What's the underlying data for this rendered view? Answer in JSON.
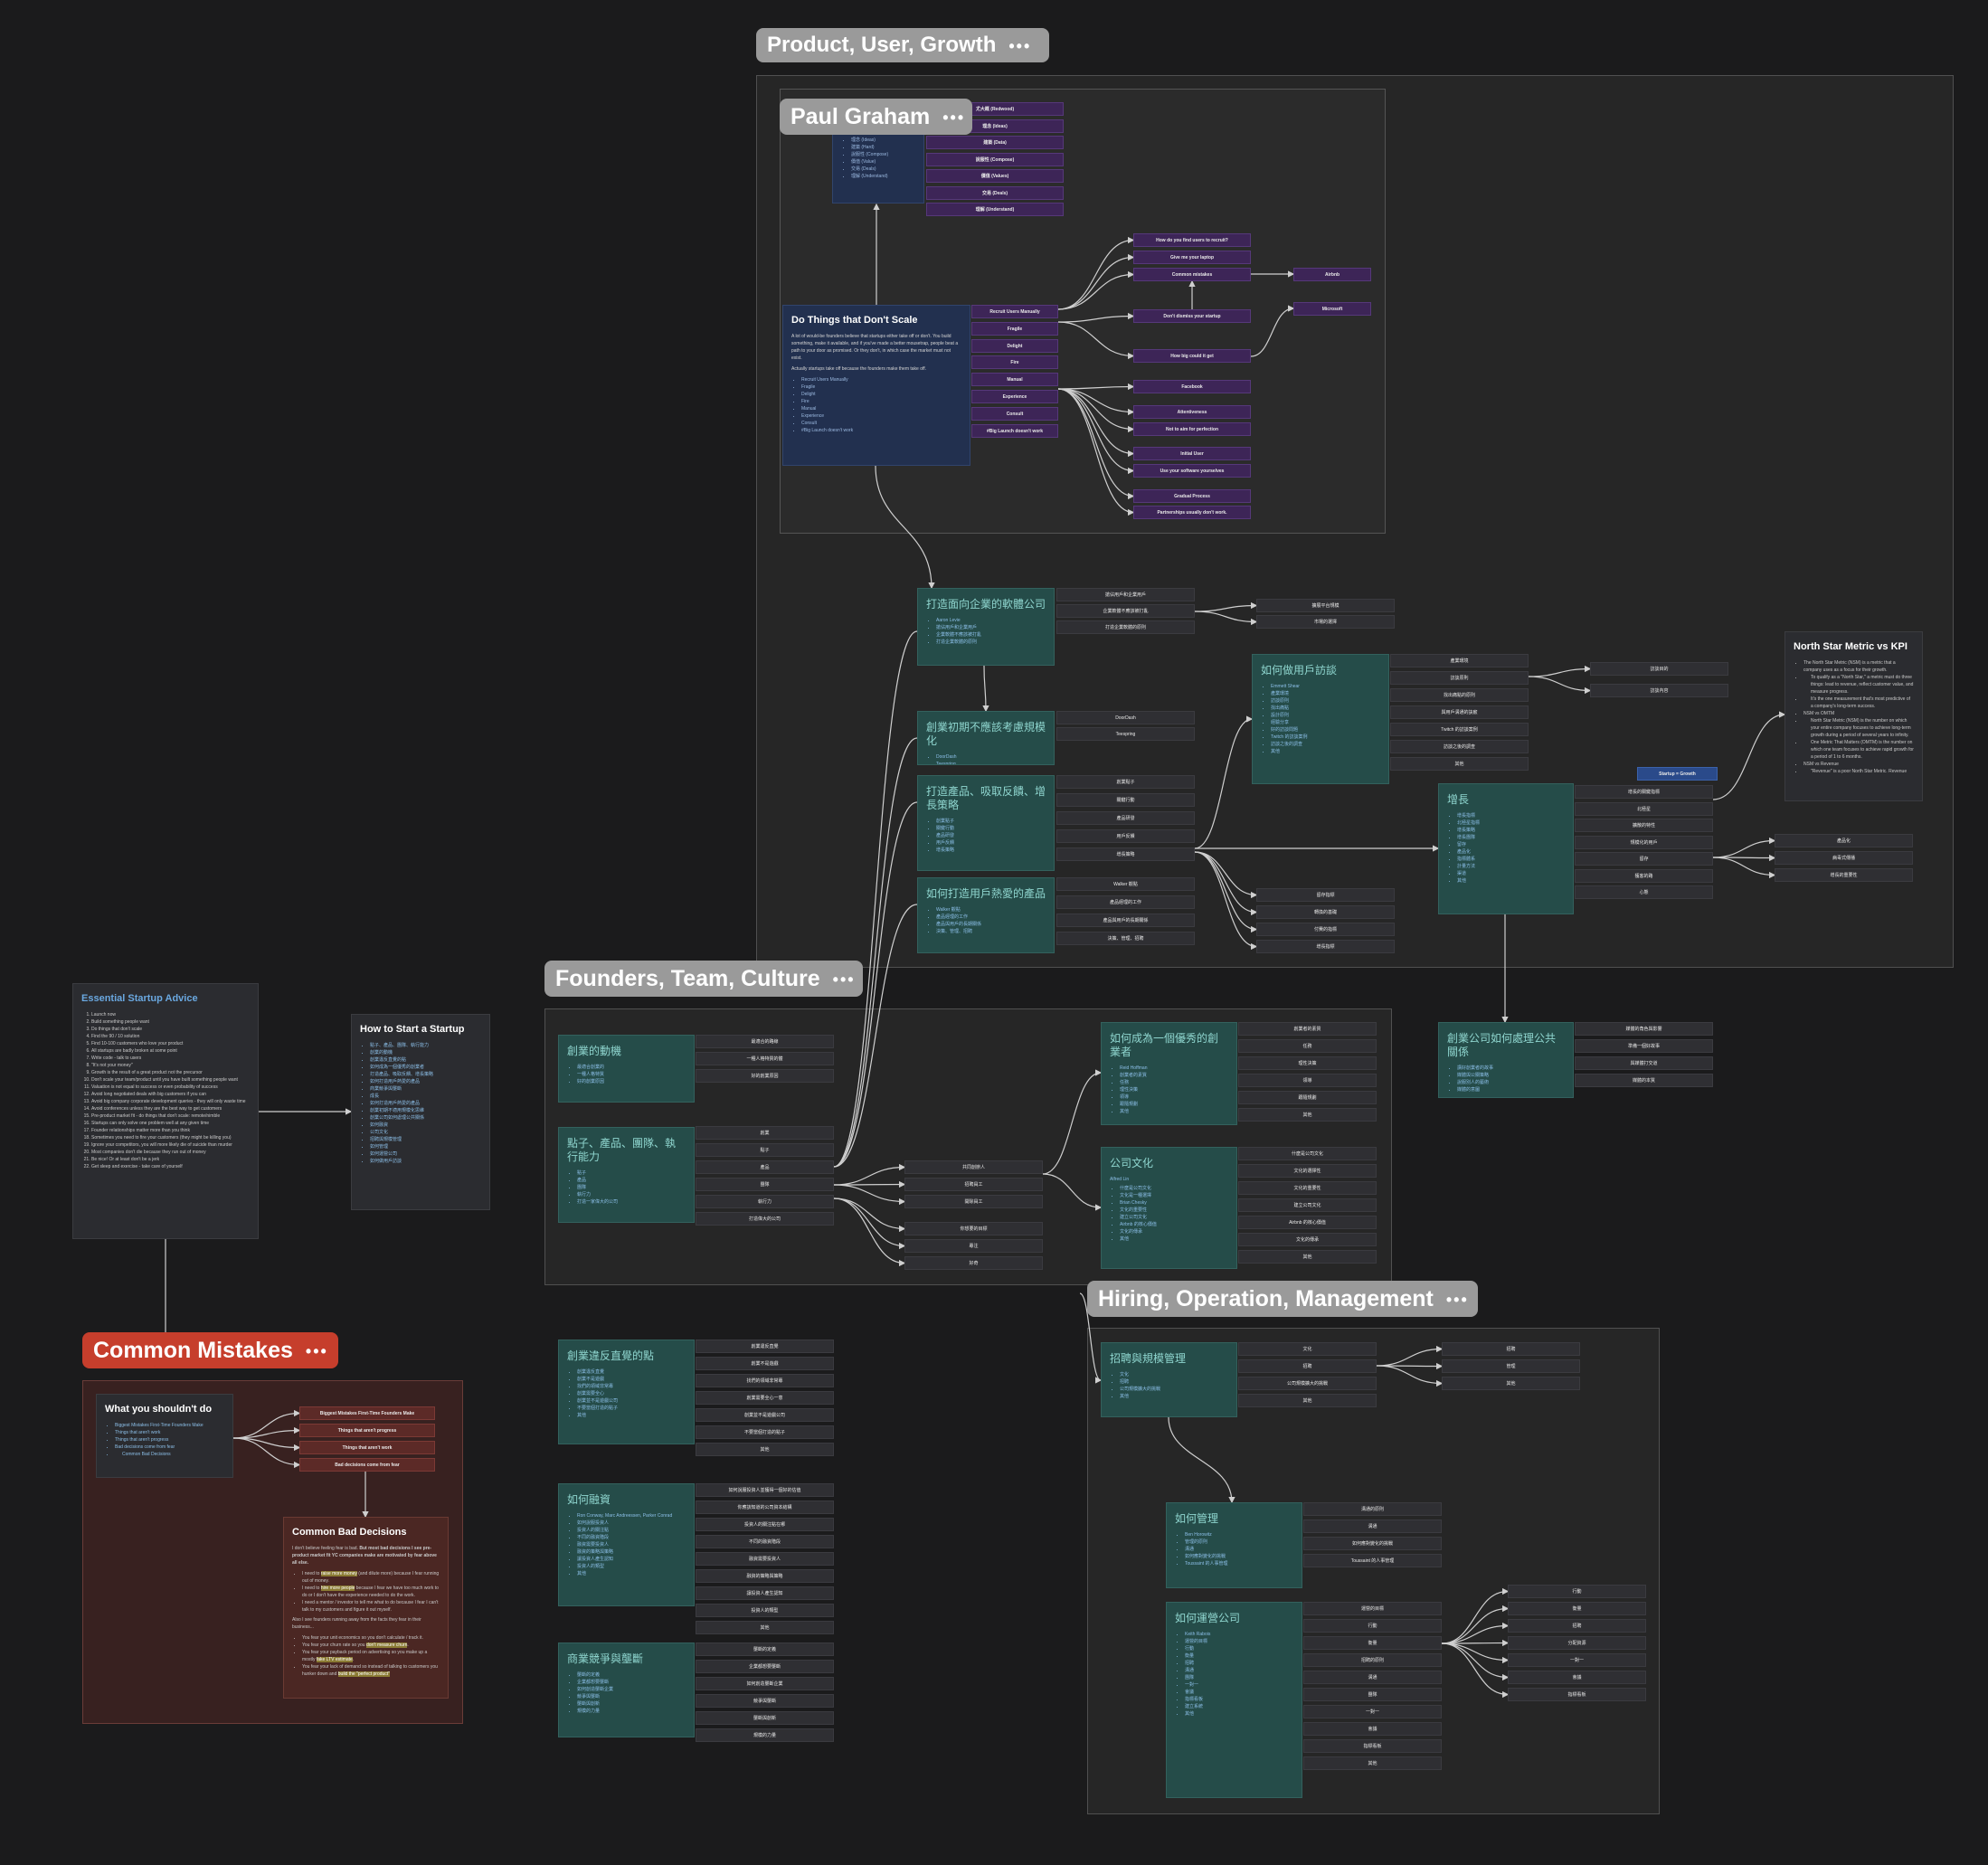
{
  "groups": {
    "product": {
      "label": "Product, User, Growth"
    },
    "paul": {
      "label": "Paul Graham"
    },
    "founders": {
      "label": "Founders, Team, Culture"
    },
    "hiring": {
      "label": "Hiring, Operation, Management"
    },
    "mistakes": {
      "label": "Common Mistakes"
    }
  },
  "label_menu": "•••",
  "notes": {
    "essential": {
      "title": "Essential Startup Advice",
      "items": [
        "Launch now",
        "Build something people want",
        "Do things that don't scale",
        "Find the 90 / 10 solution",
        "Find 10-100 customers who love your product",
        "All startups are badly broken at some point",
        "Write code - talk to users",
        "\"It's not your money\"",
        "Growth is the result of a great product not the precursor",
        "Don't scale your team/product until you have built something people want",
        "Valuation is not equal to success or even probability of success",
        "Avoid long negotiated deals with big customers if you can",
        "Avoid big company corporate development queries - they will only waste time",
        "Avoid conferences unless they are the best way to get customers",
        "Pre-product market fit - do things that don't scale: remote/nimble",
        "Startups can only solve one problem well at any given time",
        "Founder relationships matter more than you think",
        "Sometimes you need to fire your customers (they might be killing you)",
        "Ignore your competitors, you will more likely die of suicide than murder",
        "Most companies don't die because they run out of money",
        "Be nice! Or at least don't be a jerk",
        "Get sleep and exercise - take care of yourself"
      ]
    },
    "howto": {
      "title": "How to Start a Startup",
      "items": [
        "點子、產品、團隊、執行能力",
        "創業的動機",
        "創業違反直覺的點",
        "如何成為一個優秀的創業者",
        "打造產品、吸取反饋、增長策略",
        "如何打造用戶熱愛的產品",
        "商業競爭與壟斷",
        "成長",
        "如何打造用戶熱愛的產品",
        "創業初期不適用規模化思維",
        "創業公司如何處理公共關係",
        "如何融資",
        "公司文化",
        "招聘與規模管理",
        "如何管理",
        "如何運營公司",
        "如何做用戶訪談"
      ]
    },
    "dothings": {
      "title": "Do Things that Don't Scale",
      "p1": "A lot of would-be founders believe that startups either take off or don't. You build something, make it available, and if you've made a better mousetrap, people beat a path to your door as promised. Or they don't, in which case the market must not exist.",
      "p2": "Actually startups take off because the founders make them take off.",
      "items": [
        "Recruit Users Manually",
        "Fragile",
        "Delight",
        "Fire",
        "Manual",
        "Experience",
        "Consult",
        "#Big Launch doesn't work"
      ]
    },
    "pgwords": {
      "items": [
        "理念 (Ideas)",
        "建築 (Hard)",
        "說服性 (Compose)",
        "價值 (Value)",
        "交易 (Deals)",
        "理解 (Understand)"
      ]
    },
    "enterprise": {
      "title": "打造面向企業的軟體公司",
      "items": [
        "Aaron Levie",
        "搶佔用戶和企業用戶",
        "企業軟體不應該被打亂",
        "打造企業軟體的原則"
      ]
    },
    "noscale": {
      "title": "創業初期不應該考慮規模化",
      "items": [
        "DoorDash",
        "Teespring"
      ]
    },
    "feedback": {
      "title": "打造產品、吸取反饋、增長策略",
      "items": [
        "創業點子",
        "關鍵行動",
        "產品研發",
        "用戶反饋",
        "增長策略"
      ]
    },
    "lovedprod": {
      "title": "如何打造用戶熱愛的產品",
      "items": [
        "Walker 觀點",
        "產品經理的工作",
        "產品與用戶的長期關係",
        "決策、管理、招聘"
      ]
    },
    "interview": {
      "title": "如何做用戶訪談",
      "items": [
        "Emmett Shear",
        "產業環境",
        "訪談原則",
        "找出痛點",
        "設計原則",
        "經驗分享",
        "好的訪談問題",
        "Twitch 的訪談案例",
        "訪談之後的調查",
        "其他"
      ]
    },
    "growth": {
      "title": "增長",
      "items": [
        "增長指標",
        "北極星指標",
        "增長策略",
        "增長團隊",
        "留存",
        "產品化",
        "指標體系",
        "計量方法",
        "渠道",
        "其他"
      ]
    },
    "northstar": {
      "title": "North Star Metric vs KPI",
      "l1": "The North Star Metric (NSM) is a metric that a company uses as a focus for their growth.",
      "l2": "To qualify as a \"North Star,\" a metric must do three things: lead to revenue, reflect customer value, and measure progress.",
      "l3": "It's the one measurement that's most predictive of a company's long-term success.",
      "l4": "NSM vs OMTM",
      "l5": "North Star Metric (NSM) is the number on which your entire company focuses to achieve long-term growth during a period of several years to infinity.",
      "l6": "One Metric That Matters (OMTM) is the number on which one team focuses to achieve rapid growth for a period of 1 to 6 months.",
      "l7": "NSM vs Revenue",
      "l8": "\"Revenue\" is a poor North Star Metric. Revenue"
    },
    "pr": {
      "title": "創業公司如何處理公共關係",
      "items": [
        "講好創業者的故事",
        "媒體與公關策略",
        "說服別人的藝術",
        "媒體的意圖"
      ]
    },
    "motive": {
      "title": "創業的動機",
      "items": [
        "最適合創業的",
        "一種人格特質",
        "好的創業原因"
      ]
    },
    "ideas": {
      "title": "點子、產品、團隊、執行能力",
      "items": [
        "點子",
        "產品",
        "團隊",
        "執行力",
        "打造一家偉大的公司"
      ]
    },
    "founder": {
      "title": "如何成為一個優秀的創業者",
      "items": [
        "Reid Hoffman",
        "創業者的素質",
        "任務",
        "理性決策",
        "領導",
        "跟隨規劃",
        "其他"
      ]
    },
    "culture": {
      "title": "公司文化",
      "sub": "Alfred Lin",
      "items": [
        "什麼是公司文化",
        "文化是一種選擇",
        "Brian Chesky",
        "文化的重要性",
        "建立公司文化",
        "Airbnb 的核心價值",
        "文化的傳承",
        "其他"
      ]
    },
    "counter": {
      "title": "創業違反直覺的點",
      "items": [
        "創業違反直覺",
        "創業不是遊戲",
        "找們的領域非常專",
        "創業需要全心",
        "創業並不是遊戲公司",
        "不要當個打造的點子",
        "其他"
      ]
    },
    "funding": {
      "title": "如何融資",
      "items": [
        "Ron Conway, Marc Andreessen, Parker Conrad",
        "如何說服投資人",
        "投資人的關注點",
        "不同的融資階段",
        "融資需要投資人",
        "融資的策略與策略",
        "讓投資人產生認知",
        "投資人的類型",
        "其他"
      ]
    },
    "compete": {
      "title": "商業競爭與壟斷",
      "items": [
        "壟斷的定義",
        "企業都想要壟斷",
        "如何創造壟斷企業",
        "競爭與壟斷",
        "壟斷與創新",
        "規模的力量"
      ]
    },
    "hiringmgmt": {
      "title": "招聘與規模管理",
      "items": [
        "文化",
        "招聘",
        "公司規模擴大的挑戰",
        "其他"
      ]
    },
    "manage": {
      "title": "如何管理",
      "items": [
        "Ben Horowitz",
        "管理的原則",
        "溝通",
        "如何應對變化的挑戰",
        "Toussaint 的人事管理"
      ]
    },
    "operate": {
      "title": "如何運營公司",
      "items": [
        "Keith Rabois",
        "運營的目標",
        "行動",
        "衡量",
        "招聘",
        "溝通",
        "團隊",
        "一對一",
        "會議",
        "指標看板",
        "建立系統",
        "其他"
      ]
    },
    "shouldnt": {
      "title": "What you shouldn't do",
      "items": [
        "Biggest Mistakes First-Time Founders Make",
        "Things that aren't work",
        "Things that aren't progress",
        "Bad decisions come from fear",
        "Common Bad Decisions"
      ]
    },
    "baddec": {
      "title": "Common Bad Decisions",
      "p1a": "I don't believe feeling fear is bad. ",
      "p1b": "But most bad decisions I see pre-product market fit YC companies make are motivated by fear above all else.",
      "b1a": "I need to ",
      "b1h": "raise more money",
      "b1b": " (and dilute more) because I fear running out of money.",
      "b2a": "I need to ",
      "b2h": "hire more people",
      "b2b": " because I fear we have too much work to do or I don't have the experience needed to do the work.",
      "b3": "I need a mentor / investor to tell me what to do because I fear I can't talk to my customers and figure it out myself.",
      "p2": "Also I see founders running away from the facts they fear in their business...",
      "b4": "You fear your unit economics so you don't calculate / track it.",
      "b5a": "You fear your churn rate so you ",
      "b5h": "don't measure churn",
      "b5b": ".",
      "b6a": "You fear your payback period on advertising so you make up a mostly ",
      "b6h": "fake LTV estimate",
      "b6b": ".",
      "b7a": "You fear your lack of demand so instead of talking to customers you hunker down and ",
      "b7h": "build the \"perfect product\""
    }
  },
  "boxes": {
    "pgwords": [
      "尤大概 (Redwood)",
      "理念 (Ideas)",
      "建築 (Data)",
      "說服性 (Compose)",
      "價值 (Values)",
      "交易 (Deals)",
      "理解 (Understand)"
    ],
    "dts_children": [
      "Recruit Users Manually",
      "Fragile",
      "Delight",
      "Fire",
      "Manual",
      "Experience",
      "Consult",
      "#Big Launch doesn't work"
    ],
    "dts_top": [
      "How do you find users to recruit?",
      "Give me your laptop",
      "Common mistakes",
      "Don't dismiss your startup",
      "How big could it get"
    ],
    "dts_co": [
      "Airbnb",
      "Microsoft"
    ],
    "dts_bottom": [
      "Facebook",
      "Attentiveness",
      "Not to aim for perfection",
      "Initial User",
      "Use your software yourselves",
      "Gradual Process",
      "Partnerships usually don't work."
    ],
    "enterprise": [
      "搶佔用戶和企業用戶",
      "企業軟體不應該被打亂",
      "打造企業軟體的原則"
    ],
    "enterprise_sub": [
      "擴展平台規模",
      "市場的選擇"
    ],
    "noscale": [
      "DoorDash",
      "Teespring"
    ],
    "feedback": [
      "創業點子",
      "關鍵行動",
      "產品研發",
      "用戶反饋",
      "增長策略"
    ],
    "lovedprod": [
      "Walker 觀點",
      "產品經理的工作",
      "產品與用戶的長期關係",
      "決策、管理、招聘"
    ],
    "feedback_sub": [
      "留存指標",
      "轉換的基礎",
      "付費的指標",
      "增長指標"
    ],
    "interview": [
      "產業環境",
      "訪談原則",
      "找出痛點的原則",
      "與用戶溝通的訣竅",
      "Twitch 的訪談案例",
      "訪談之後的調查",
      "其他"
    ],
    "interview_sub": [
      "訪談目的",
      "訪談內容"
    ],
    "startup_growth": "Startup = Growth",
    "growth": [
      "增長的關鍵指標",
      "北極星",
      "擴散的特性",
      "規模化的用戶",
      "留存",
      "獲客的路",
      "心態"
    ],
    "growth_sub": [
      "產品化",
      "病毒式傳播",
      "增長的重要性"
    ],
    "pr": [
      "媒體的角色與影響",
      "準備一個好故事",
      "與媒體打交道",
      "媒體的本質"
    ],
    "motive": [
      "最適合的路線",
      "一種人格特質的體",
      "好的創業原因"
    ],
    "ideas": [
      "創業",
      "點子",
      "產品",
      "團隊",
      "執行力",
      "打造偉大的公司"
    ],
    "ideas_mid": [
      "共同創辦人",
      "招聘員工",
      "開除員工"
    ],
    "ideas_bottom": [
      "你想要的目標",
      "專注",
      "好奇"
    ],
    "founder": [
      "創業者的素質",
      "任務",
      "理性決策",
      "領導",
      "跟隨規劃",
      "其他"
    ],
    "culture": [
      "什麼是公司文化",
      "文化的選擇性",
      "文化的重要性",
      "建立公司文化",
      "Airbnb 的核心價值",
      "文化的傳承",
      "其他"
    ],
    "counter": [
      "創業違反直覺",
      "創業不是遊戲",
      "找們的領域非常專",
      "創業需要全心一意",
      "創業並不是遊戲公司",
      "不要當個打造的點子",
      "其他"
    ],
    "funding": [
      "如何說服投資人並獲得一個好的估值",
      "你應該知道的公司資本結構",
      "投資人的關注點在哪",
      "不同的融資階段",
      "融資需要投資人",
      "融資的策略與策略",
      "讓投資人產生認知",
      "投資人的類型",
      "其他"
    ],
    "compete": [
      "壟斷的定義",
      "企業都想要壟斷",
      "如何創造壟斷企業",
      "競爭與壟斷",
      "壟斷與創新",
      "規模的力量"
    ],
    "hiringmgmt": [
      "文化",
      "招聘",
      "公司規模擴大的挑戰",
      "其他"
    ],
    "hiring_sub": [
      "招聘",
      "管理",
      "其他"
    ],
    "manage": [
      "溝通的原則",
      "溝通",
      "如何應對變化的挑戰",
      "Toussaint 的人事管理"
    ],
    "operate": [
      "運營的目標",
      "行動",
      "衡量",
      "招聘的原則",
      "溝通",
      "團隊",
      "一對一",
      "會議",
      "指標看板",
      "其他"
    ],
    "operate_sub": [
      "行動",
      "衡量",
      "招聘",
      "分配資源",
      "一對一",
      "會議",
      "指標看板"
    ],
    "mistakes": [
      "Biggest Mistakes First-Time Founders Make",
      "Things that aren't progress",
      "Things that aren't work",
      "Bad decisions come from fear"
    ]
  },
  "colors": {
    "background": "#1b1b1c",
    "edge": "#cfcfcf",
    "teal": "#254c49",
    "navy": "#22304f",
    "purple": "#3d2557",
    "red_group": "#c63e2c"
  }
}
